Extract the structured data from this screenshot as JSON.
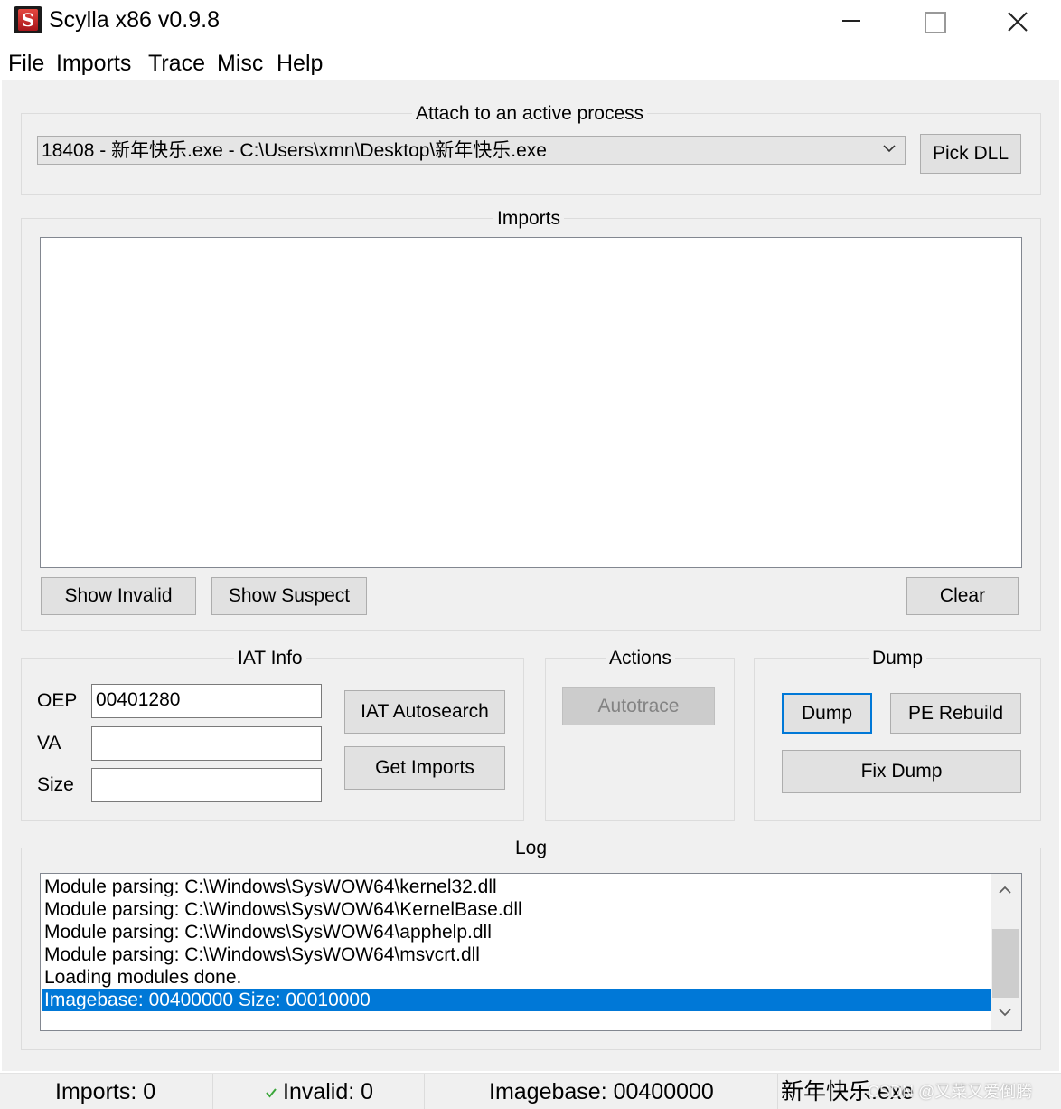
{
  "window": {
    "title": "Scylla x86 v0.9.8",
    "app_icon_letter": "S"
  },
  "menu": [
    "File",
    "Imports",
    "Trace",
    "Misc",
    "Help"
  ],
  "attach": {
    "group_title": "Attach to an active process",
    "process_selected": "18408 - 新年快乐.exe - C:\\Users\\xmn\\Desktop\\新年快乐.exe",
    "pick_dll_label": "Pick DLL"
  },
  "imports": {
    "group_title": "Imports",
    "show_invalid_label": "Show Invalid",
    "show_suspect_label": "Show Suspect",
    "clear_label": "Clear"
  },
  "iat_info": {
    "group_title": "IAT Info",
    "oep_label": "OEP",
    "oep_value": "00401280",
    "va_label": "VA",
    "va_value": "",
    "size_label": "Size",
    "size_value": "",
    "autosearch_label": "IAT Autosearch",
    "get_imports_label": "Get Imports"
  },
  "actions": {
    "group_title": "Actions",
    "autotrace_label": "Autotrace"
  },
  "dump": {
    "group_title": "Dump",
    "dump_label": "Dump",
    "pe_rebuild_label": "PE Rebuild",
    "fix_dump_label": "Fix Dump"
  },
  "log": {
    "group_title": "Log",
    "lines": [
      "Module parsing: C:\\Windows\\SysWOW64\\kernel32.dll",
      "Module parsing: C:\\Windows\\SysWOW64\\KernelBase.dll",
      "Module parsing: C:\\Windows\\SysWOW64\\apphelp.dll",
      "Module parsing: C:\\Windows\\SysWOW64\\msvcrt.dll",
      "Loading modules done.",
      "Imagebase: 00400000 Size: 00010000"
    ],
    "selected_line": 5
  },
  "status": {
    "imports": "Imports: 0",
    "invalid": "Invalid: 0",
    "imagebase": "Imagebase: 00400000",
    "module": "新年快乐.exe",
    "watermark": "CSDN @又菜又爱倒腾"
  },
  "colors": {
    "selection": "#0078d7",
    "focus_border": "#0078d7",
    "client_bg": "#f0f0f0",
    "check": "#3aa63a"
  }
}
